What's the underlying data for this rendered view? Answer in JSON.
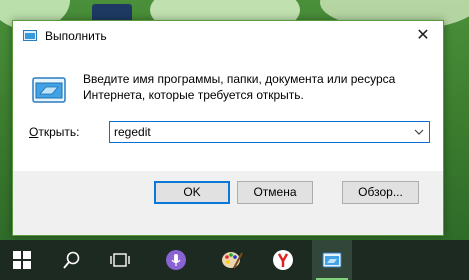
{
  "dialog": {
    "title": "Выполнить",
    "close_label": "✕",
    "description": "Введите имя программы, папки, документа или ресурса Интернета, которые требуется открыть.",
    "open_label_prefix": "О",
    "open_label_rest": "ткрыть:",
    "input_value": "regedit"
  },
  "buttons": {
    "ok": "OK",
    "cancel": "Отмена",
    "browse": "Обзор..."
  },
  "taskbar": {
    "items": [
      {
        "icon": "windows-start-icon"
      },
      {
        "icon": "search-icon"
      },
      {
        "icon": "task-view-icon"
      },
      {
        "icon": "microphone-icon"
      },
      {
        "icon": "paint-palette-icon"
      },
      {
        "icon": "yandex-browser-icon"
      },
      {
        "icon": "run-dialog-icon"
      }
    ]
  },
  "colors": {
    "accent": "#0b78d7",
    "dialog_border": "#5a9a3e",
    "footer_bg": "#f0f0f0",
    "taskbar_bg": "#1c2a22",
    "cortana": "#8a63d2",
    "yandex_red": "#e02020"
  }
}
